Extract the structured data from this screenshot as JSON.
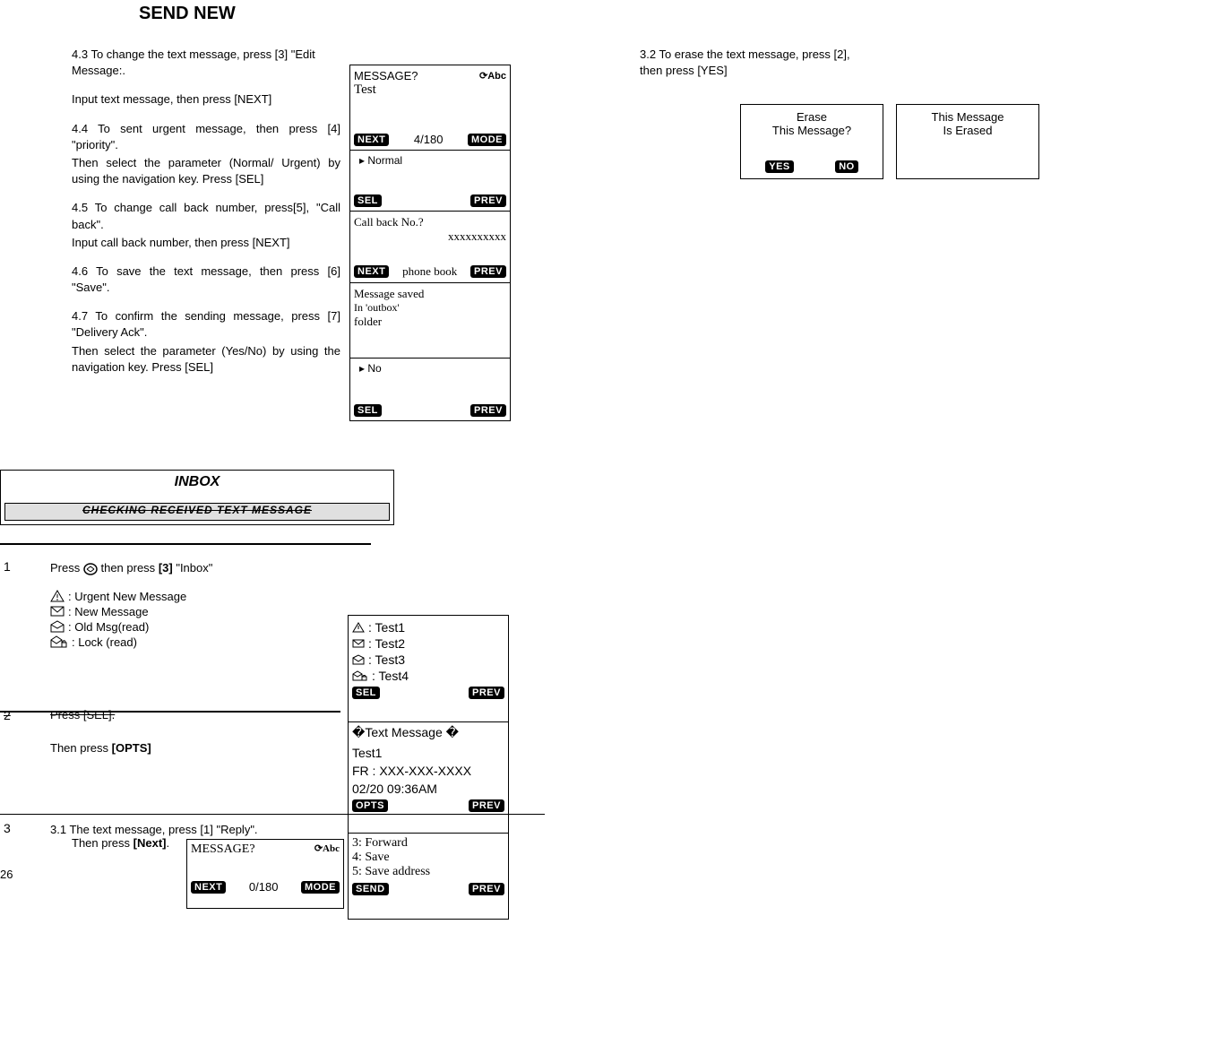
{
  "title": "SEND NEW",
  "left": {
    "p43a": "4.3 To change the text message, press [3] \"Edit Message:.",
    "p43b": "Input text message, then press [NEXT]",
    "p44a": "4.4 To sent urgent message, then press [4] \"priority\".",
    "p44b": "Then select the parameter (Normal/ Urgent) by using the navigation key. Press [SEL]",
    "p45a": "4.5 To change call back number, press[5], \"Call back\".",
    "p45b": "Input call back number, then press [NEXT]",
    "p46": "4.6 To save the text message, then press [6] \"Save\".",
    "p47a": "4.7 To confirm the sending message, press [7] \"Delivery Ack\".",
    "p47b": "Then select the parameter (Yes/No) by using the navigation key. Press [SEL]"
  },
  "phones": {
    "a": {
      "header": "MESSAGE?",
      "body": "Test",
      "left": "NEXT",
      "center": "4/180",
      "right": "MODE",
      "abc": "Abc"
    },
    "b": {
      "body": "Normal",
      "left": "SEL",
      "right": "PREV"
    },
    "c": {
      "line1": "Call back No.?",
      "line2": "xxxxxxxxxx",
      "line3": "phone book",
      "left": "NEXT",
      "right": "PREV"
    },
    "d": {
      "line1": "Message saved",
      "line2": "In 'outbox'",
      "line3": "folder"
    },
    "e": {
      "body": "No",
      "left": "SEL",
      "right": "PREV"
    }
  },
  "right": {
    "p32a": "3.2 To erase the text message, press [2],",
    "p32b": "then press [YES]"
  },
  "dialogs": {
    "erase": {
      "l1": "Erase",
      "l2": "This Message?",
      "yes": "YES",
      "no": "NO"
    },
    "erased": {
      "l1": "This Message",
      "l2": "Is Erased"
    }
  },
  "inbox": {
    "title": "INBOX",
    "banner": "CHECKING RECEIVED TEXT MESSAGE"
  },
  "step1": {
    "num": "1",
    "text_a": "Press",
    "text_b": "then press",
    "text_c": "[3]",
    "text_d": "\"Inbox\"",
    "legend": {
      "urgent": ": Urgent New Message",
      "new": ":  New Message",
      "old": ": Old Msg(read)",
      "lock": ": Lock (read)"
    }
  },
  "inboxList": {
    "t1": ": Test1",
    "t2": ": Test2",
    "t3": ": Test3",
    "t4": ": Test4",
    "left": "SEL",
    "right": "PREV"
  },
  "step2": {
    "num": "2",
    "text": "Press [SEL].",
    "then": "Then press",
    "opts": "[OPTS]"
  },
  "msgView": {
    "l1": "�Text Message �",
    "l2": "Test1",
    "l3": "FR : XXX-XXX-XXXX",
    "l4": "02/20 09:36AM",
    "left": "OPTS",
    "right": "PREV"
  },
  "step3": {
    "num": "3",
    "l1": "3.1 The text message, press [1] \"Reply\".",
    "l2_a": "Then press",
    "l2_b": "[Next]",
    "dot": "."
  },
  "replyBox": {
    "header": "MESSAGE?",
    "left": "NEXT",
    "center": "0/180",
    "right": "MODE",
    "abc": "Abc"
  },
  "optsMenu": {
    "l1": "3: Forward",
    "l2": "4: Save",
    "l3": "5: Save address",
    "left": "SEND",
    "right": "PREV"
  },
  "pageNumber": "26"
}
